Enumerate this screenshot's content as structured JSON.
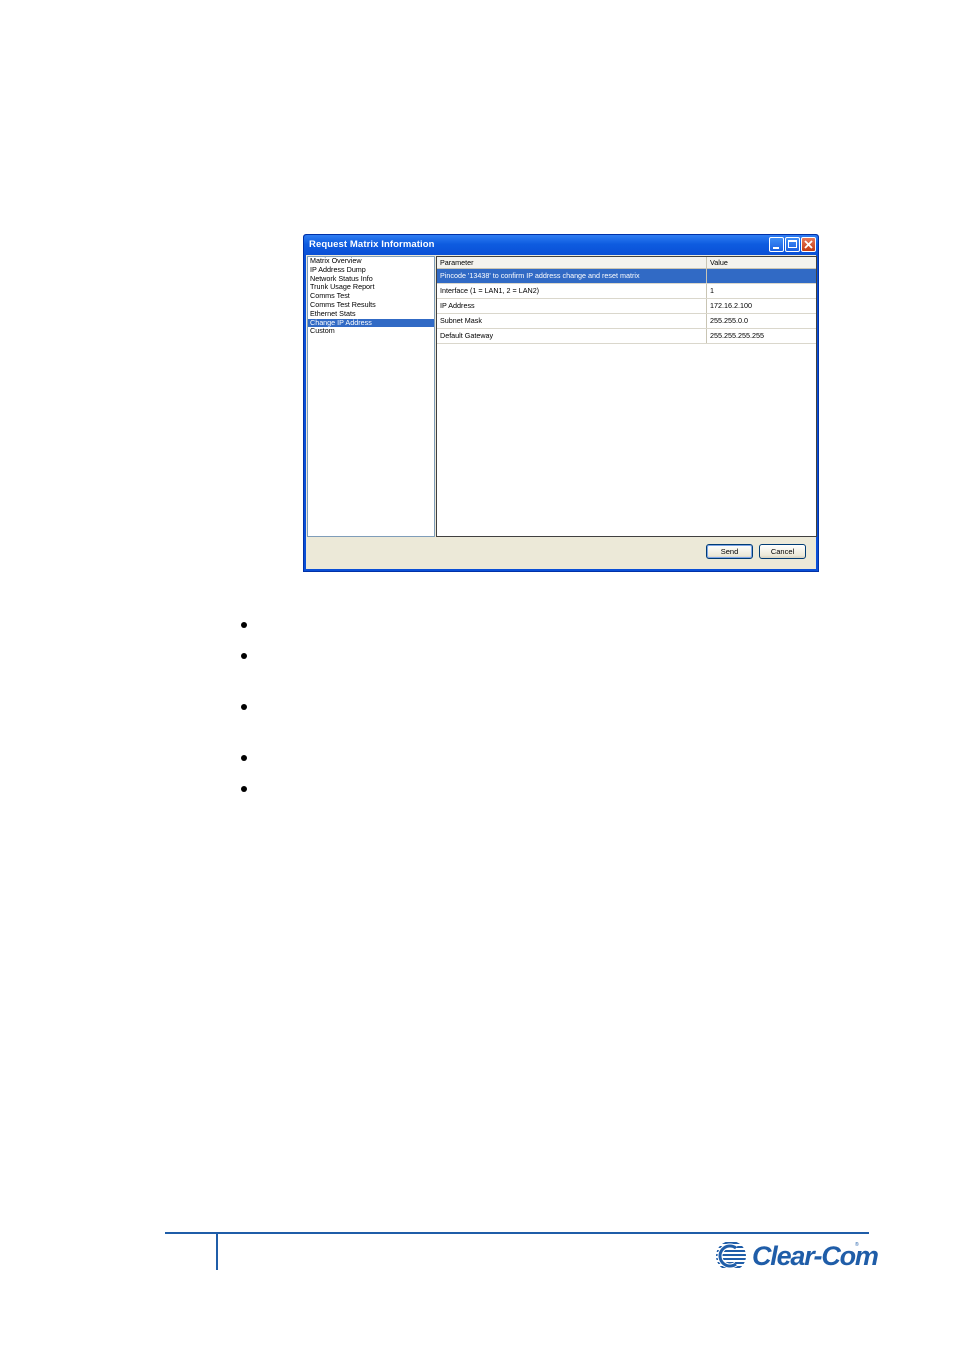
{
  "dialog": {
    "title": "Request Matrix Information",
    "list_items": [
      "Matrix Overview",
      "IP Address Dump",
      "Network Status Info",
      "Trunk Usage Report",
      "Comms Test",
      "Comms Test Results",
      "Ethernet Stats",
      "Change IP Address",
      "Custom"
    ],
    "selected_list_item": "Change IP Address",
    "grid": {
      "columns": [
        "Parameter",
        "Value"
      ],
      "rows": [
        {
          "parameter": "Pincode '13438' to confirm IP address change and reset matrix",
          "value": ""
        },
        {
          "parameter": "Interface (1 = LAN1, 2 = LAN2)",
          "value": "1"
        },
        {
          "parameter": "IP Address",
          "value": "172.16.2.100"
        },
        {
          "parameter": "Subnet Mask",
          "value": "255.255.0.0"
        },
        {
          "parameter": "Default Gateway",
          "value": "255.255.255.255"
        }
      ]
    },
    "buttons": {
      "send": "Send",
      "cancel": "Cancel"
    },
    "colors": {
      "titlebar": "#0a4fd6",
      "selection": "#316ac5",
      "window_face": "#ece9d8"
    }
  },
  "footer": {
    "logo_text": "Clear-Com",
    "registered_mark": "®",
    "logo_icon": "clear-com-globe-icon",
    "rule_color": "#1f5da8"
  }
}
